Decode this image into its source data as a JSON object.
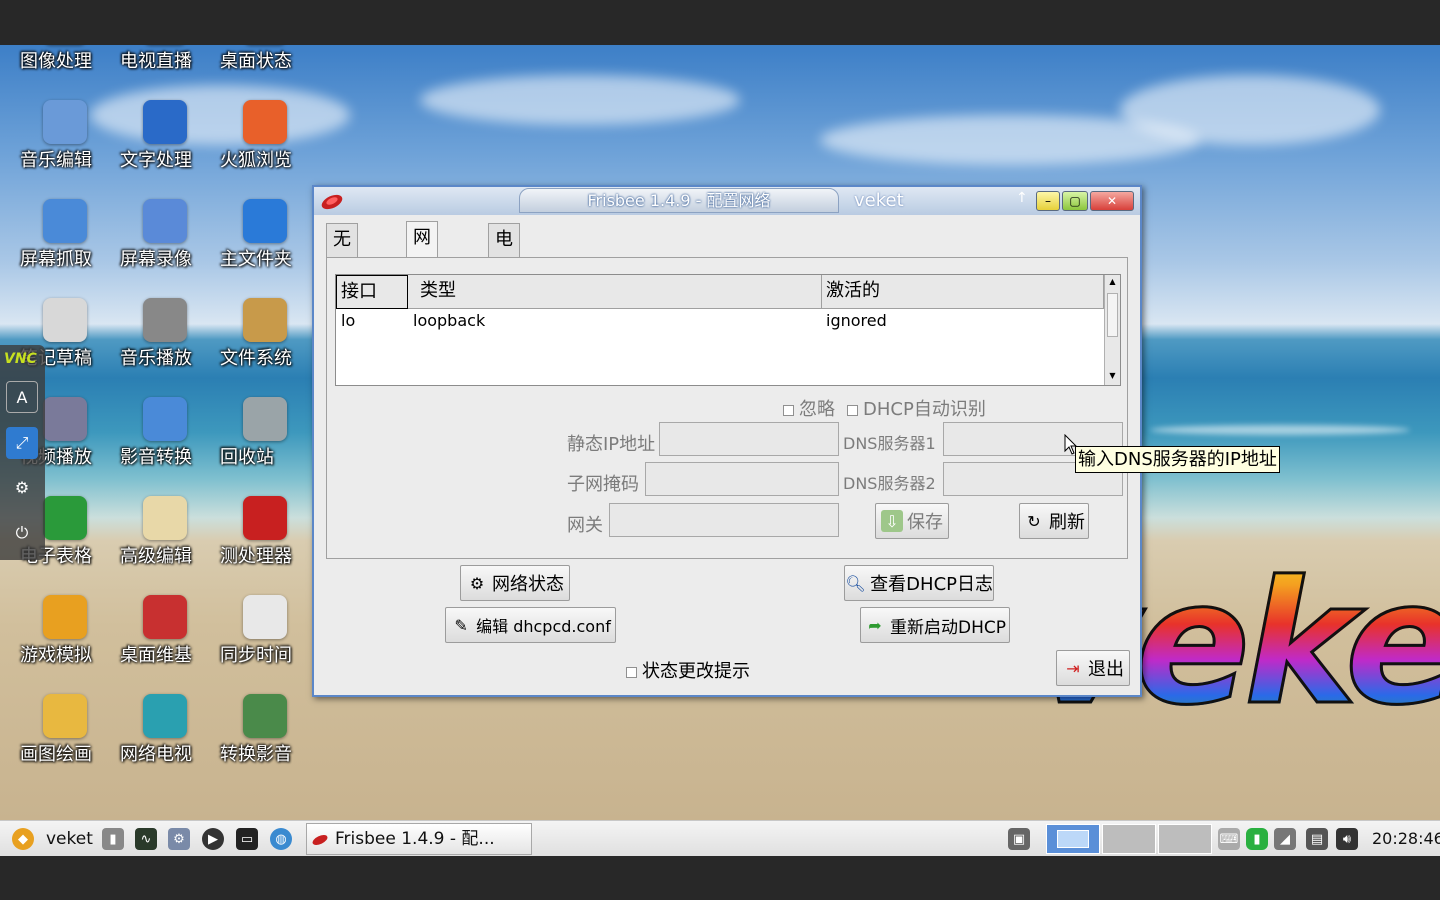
{
  "desktop": {
    "icons": [
      {
        "label": "图像处理",
        "icon": "image-icon"
      },
      {
        "label": "电视直播",
        "icon": "tv-icon"
      },
      {
        "label": "桌面状态",
        "icon": "desktop-status-icon"
      },
      {
        "label": "音乐编辑",
        "icon": "music-edit-icon"
      },
      {
        "label": "文字处理",
        "icon": "word-icon"
      },
      {
        "label": "火狐浏览",
        "icon": "firefox-icon"
      },
      {
        "label": "屏幕抓取",
        "icon": "screenshot-icon"
      },
      {
        "label": "屏幕录像",
        "icon": "screen-record-icon"
      },
      {
        "label": "主文件夹",
        "icon": "home-folder-icon"
      },
      {
        "label": "笔记草稿",
        "icon": "notes-icon"
      },
      {
        "label": "音乐播放",
        "icon": "speaker-icon"
      },
      {
        "label": "文件系统",
        "icon": "filesystem-icon"
      },
      {
        "label": "视频播放",
        "icon": "video-icon"
      },
      {
        "label": "影音转换",
        "icon": "media-convert-icon"
      },
      {
        "label": "回收站",
        "icon": "trash-icon"
      },
      {
        "label": "电子表格",
        "icon": "excel-icon"
      },
      {
        "label": "高级编辑",
        "icon": "editor-icon"
      },
      {
        "label": "测处理器",
        "icon": "cpu-icon"
      },
      {
        "label": "游戏模拟",
        "icon": "game-icon"
      },
      {
        "label": "桌面维基",
        "icon": "wiki-icon"
      },
      {
        "label": "同步时间",
        "icon": "calendar-icon"
      },
      {
        "label": "画图绘画",
        "icon": "paint-icon"
      },
      {
        "label": "网络电视",
        "icon": "play-icon"
      },
      {
        "label": "转换影音",
        "icon": "convert-icon"
      }
    ],
    "vnc_label": "VNC",
    "logo_text": "veket"
  },
  "window": {
    "title": "Frisbee  1.4.9 - 配置网络",
    "owner": "veket",
    "tabs": [
      "无线网络",
      "网络接口",
      "电话网络"
    ],
    "active_tab": 1,
    "table": {
      "headers": [
        "接口",
        "类型",
        "激活的"
      ],
      "rows": [
        [
          "lo",
          "loopback",
          "ignored"
        ]
      ]
    },
    "ignore_label": "忽略",
    "dhcp_auto_label": "DHCP自动识别",
    "static_ip_label": "静态IP地址",
    "subnet_label": "子网掩码",
    "gateway_label": "网关",
    "dns1_label": "DNS服务器1",
    "dns2_label": "DNS服务器2",
    "save_label": "保存",
    "refresh_label": "刷新",
    "net_status_label": "网络状态",
    "view_dhcp_log_label": "查看DHCP日志",
    "edit_dhcpcd_label": "编辑 dhcpcd.conf",
    "restart_dhcp_label": "重新启动DHCP",
    "status_change_label": "状态更改提示",
    "exit_label": "退出"
  },
  "tooltip": "输入DNS服务器的IP地址",
  "taskbar": {
    "menu_label": "veket",
    "task_label": "Frisbee  1.4.9 - 配...",
    "clock": "20:28:46"
  }
}
